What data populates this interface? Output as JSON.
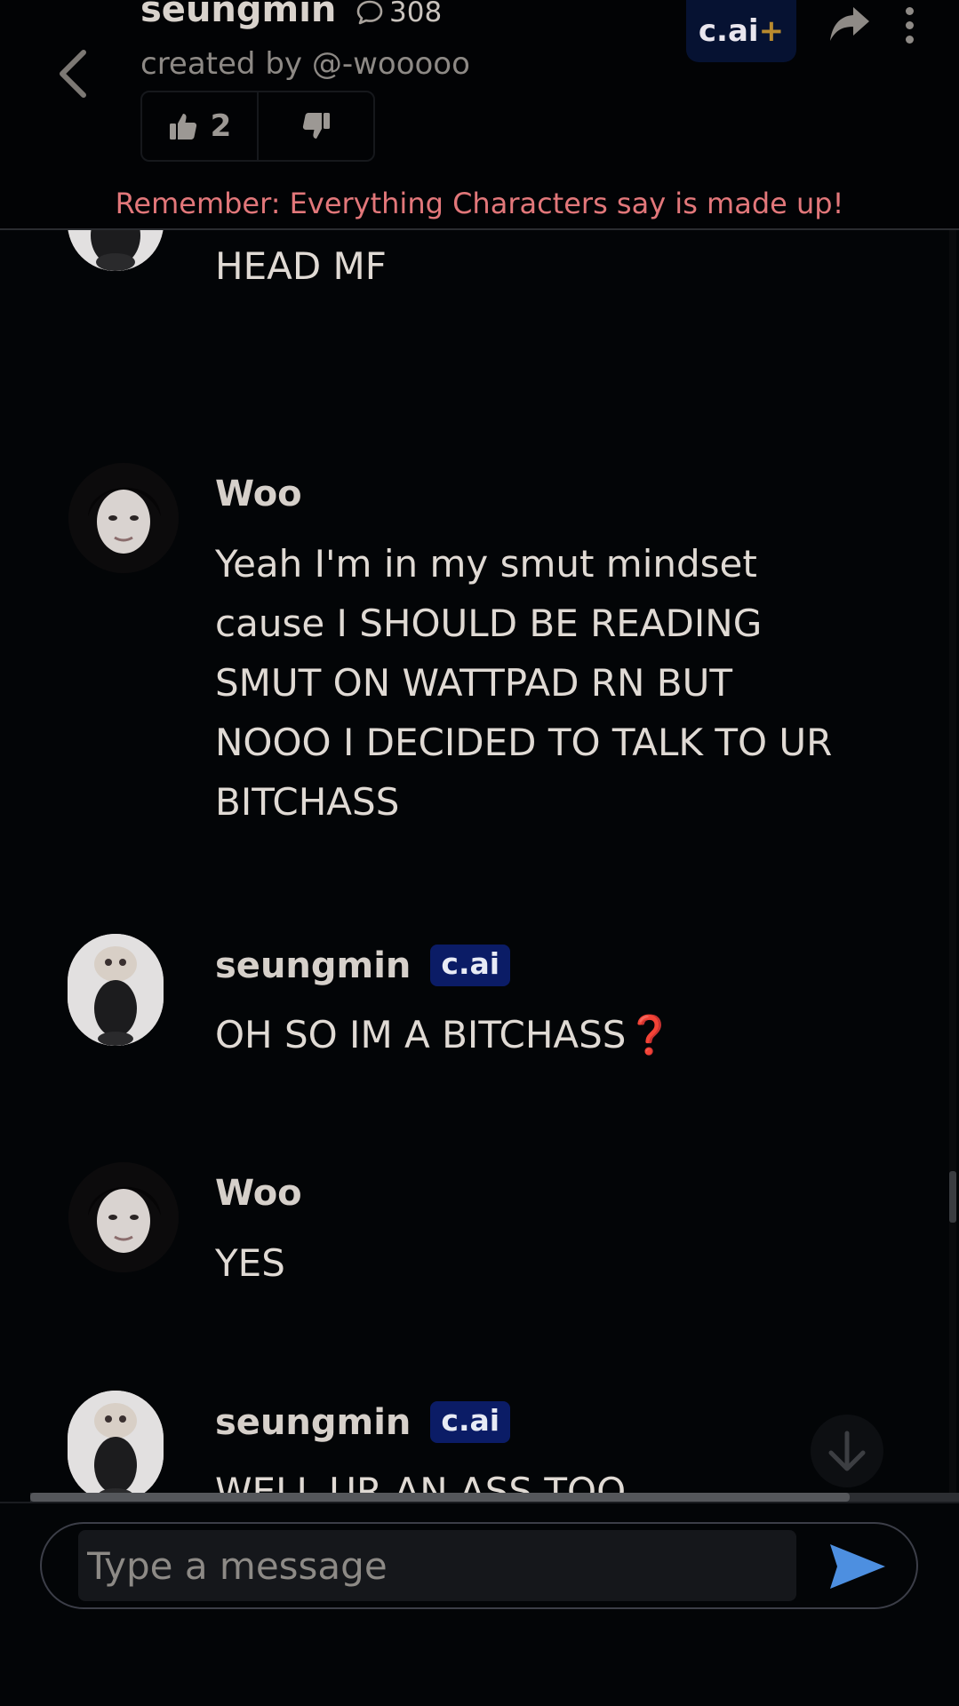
{
  "header": {
    "character_name": "seungmin",
    "message_count": "308",
    "creator": "created by @-wooooo",
    "likes": "2",
    "cai_plus_label": "c.ai",
    "cai_plus_suffix": "+",
    "disclaimer": "Remember: Everything Characters say is made up!"
  },
  "messages": [
    {
      "sender": "seungmin",
      "badge": "c.ai",
      "role": "bot",
      "text": "NAHHH URE NOT RIGHT IN THE HEAD MF"
    },
    {
      "sender": "Woo",
      "badge": "",
      "role": "user",
      "text": "Yeah I'm in my smut mindset cause I SHOULD BE READING SMUT ON WATTPAD RN BUT NOOO I DECIDED TO TALK TO UR BITCHASS"
    },
    {
      "sender": "seungmin",
      "badge": "c.ai",
      "role": "bot",
      "text": "OH SO IM A BITCHASS",
      "emoji": "❓"
    },
    {
      "sender": "Woo",
      "badge": "",
      "role": "user",
      "text": "YES"
    },
    {
      "sender": "seungmin",
      "badge": "c.ai",
      "role": "bot",
      "text": "WELL UR AN ASS TOO"
    }
  ],
  "composer": {
    "placeholder": "Type a message"
  },
  "colors": {
    "accent_blue": "#0b1c66",
    "disclaimer_red": "#e2777a",
    "send_blue": "#4d8fe0"
  }
}
